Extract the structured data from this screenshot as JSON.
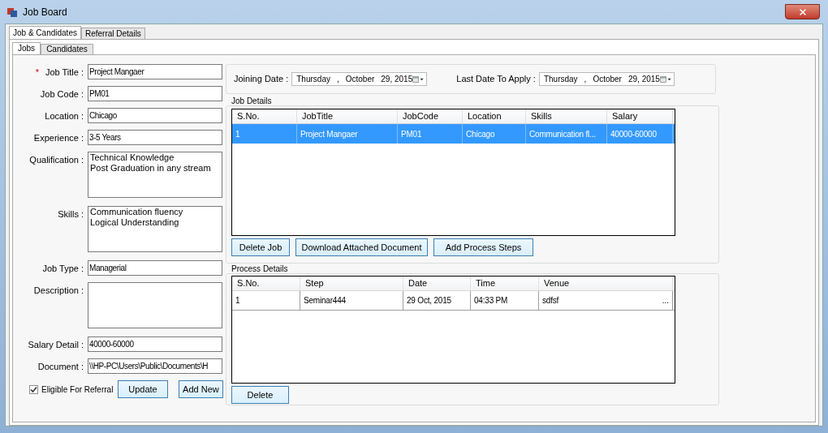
{
  "window": {
    "title": "Job Board"
  },
  "outer_tabs": [
    {
      "label": "Job & Candidates",
      "selected": true
    },
    {
      "label": "Referral Details",
      "selected": false
    }
  ],
  "inner_tabs": [
    {
      "label": "Jobs",
      "selected": true
    },
    {
      "label": "Candidates",
      "selected": false
    }
  ],
  "form": {
    "fields": [
      {
        "label": "Job Title :",
        "value": "Project Mangaer",
        "kind": "text",
        "required_mark": "*"
      },
      {
        "label": "Job Code :",
        "value": "PM01",
        "kind": "text"
      },
      {
        "label": "Location :",
        "value": "Chicago",
        "kind": "text"
      },
      {
        "label": "Experience :",
        "value": "3-5 Years",
        "kind": "text"
      },
      {
        "label": "Qualification :",
        "value": "Technical Knowledge\nPost Graduation in any stream",
        "kind": "multiline"
      },
      {
        "label": "Skills :",
        "value": "Communication fluency\nLogical Understanding",
        "kind": "multiline"
      },
      {
        "label": "Job Type :",
        "value": "Managerial",
        "kind": "text"
      },
      {
        "label": "Description :",
        "kind": "multiline"
      },
      {
        "label": "Salary Detail :",
        "value": "40000-60000",
        "kind": "text"
      },
      {
        "label": "Document :",
        "value": "\\\\HP-PC\\Users\\Public\\Documents\\H",
        "kind": "text"
      }
    ],
    "eligible": {
      "label": "Eligible For Referral",
      "checked": true
    },
    "buttons": [
      "Update",
      "Add New"
    ]
  },
  "dates": [
    {
      "label": "Joining Date :",
      "weekday": "Thursday",
      "separator": ",",
      "month": "October",
      "day": "29, 2015"
    },
    {
      "label": "Last Date To Apply :",
      "weekday": "Thursday",
      "separator": ",",
      "month": "October",
      "day": "29, 2015"
    }
  ],
  "job_details": {
    "title": "Job Details",
    "columns": [
      "S.No.",
      "JobTitle",
      "JobCode",
      "Location",
      "Skills",
      "Salary"
    ],
    "rows": [
      {
        "selected": true,
        "cells": [
          "1",
          "Project Mangaer",
          "PM01",
          "Chicago",
          "Communication fl...",
          "40000-60000"
        ]
      }
    ],
    "buttons": [
      "Delete Job",
      "Download Attached Document",
      "Add Process Steps"
    ]
  },
  "process_details": {
    "title": "Process Details",
    "columns": [
      "S.No.",
      "Step",
      "Date",
      "Time",
      "Venue"
    ],
    "rows": [
      {
        "selected": false,
        "cells": [
          "1",
          "Seminar444",
          "29 Oct, 2015",
          "04:33 PM",
          "sdfsf"
        ],
        "ellipsis": "..."
      }
    ],
    "buttons": [
      "Delete"
    ]
  }
}
